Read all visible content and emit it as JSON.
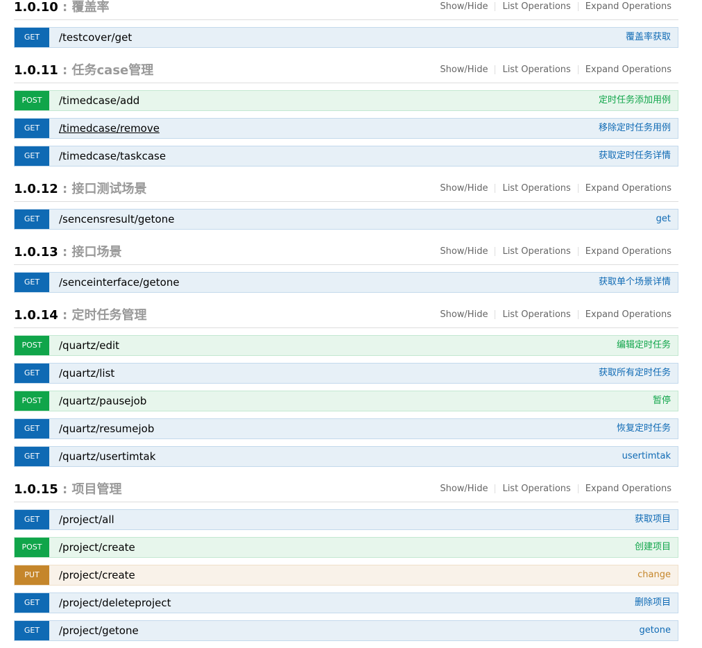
{
  "ops_labels": {
    "show_hide": "Show/Hide",
    "list": "List Operations",
    "expand": "Expand Operations"
  },
  "colors": {
    "get": "#0f6ab4",
    "post": "#10a54a",
    "put": "#c5862b"
  },
  "sections": [
    {
      "version": "1.0.10",
      "sep": " : ",
      "name": "覆盖率",
      "ops": [
        {
          "method": "GET",
          "path": "/testcover/get",
          "summary": "覆盖率获取"
        }
      ]
    },
    {
      "version": "1.0.11",
      "sep": " : ",
      "name": "任务case管理",
      "ops": [
        {
          "method": "POST",
          "path": "/timedcase/add",
          "summary": "定时任务添加用例"
        },
        {
          "method": "GET",
          "path": "/timedcase/remove",
          "summary": "移除定时任务用例"
        },
        {
          "method": "GET",
          "path": "/timedcase/taskcase",
          "summary": "获取定时任务详情"
        }
      ]
    },
    {
      "version": "1.0.12",
      "sep": " : ",
      "name": "接口测试场景",
      "ops": [
        {
          "method": "GET",
          "path": "/sencensresult/getone",
          "summary": "get"
        }
      ]
    },
    {
      "version": "1.0.13",
      "sep": " : ",
      "name": "接口场景",
      "ops": [
        {
          "method": "GET",
          "path": "/senceinterface/getone",
          "summary": "获取单个场景详情"
        }
      ]
    },
    {
      "version": "1.0.14",
      "sep": " : ",
      "name": "定时任务管理",
      "ops": [
        {
          "method": "POST",
          "path": "/quartz/edit",
          "summary": "编辑定时任务"
        },
        {
          "method": "GET",
          "path": "/quartz/list",
          "summary": "获取所有定时任务"
        },
        {
          "method": "POST",
          "path": "/quartz/pausejob",
          "summary": "暂停"
        },
        {
          "method": "GET",
          "path": "/quartz/resumejob",
          "summary": "恢复定时任务"
        },
        {
          "method": "GET",
          "path": "/quartz/usertimtak",
          "summary": "usertimtak"
        }
      ]
    },
    {
      "version": "1.0.15",
      "sep": " : ",
      "name": "项目管理",
      "ops": [
        {
          "method": "GET",
          "path": "/project/all",
          "summary": "获取项目"
        },
        {
          "method": "POST",
          "path": "/project/create",
          "summary": "创建项目"
        },
        {
          "method": "PUT",
          "path": "/project/create",
          "summary": "change"
        },
        {
          "method": "GET",
          "path": "/project/deleteproject",
          "summary": "删除项目"
        },
        {
          "method": "GET",
          "path": "/project/getone",
          "summary": "getone"
        }
      ]
    }
  ]
}
